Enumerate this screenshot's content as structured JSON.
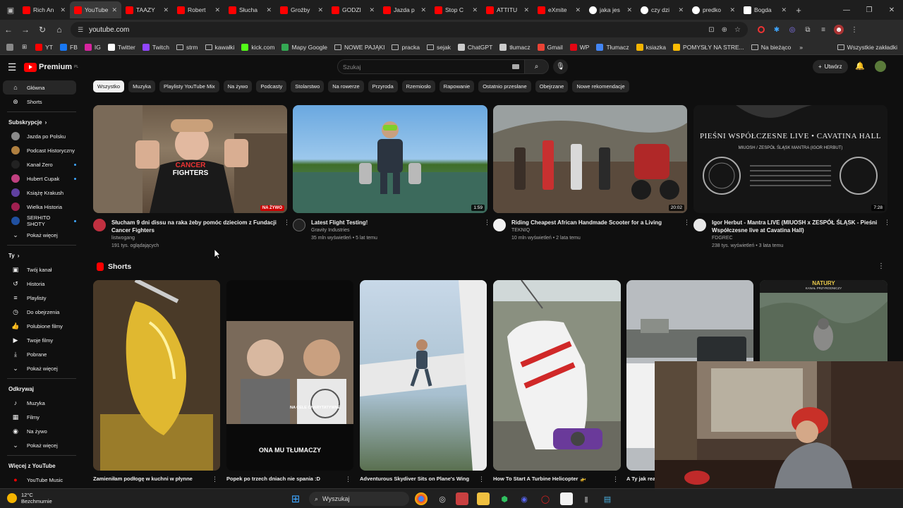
{
  "browser": {
    "tabs": [
      {
        "title": "Rich An",
        "icon": "youtube-icon"
      },
      {
        "title": "YouTube",
        "icon": "youtube-icon",
        "active": true
      },
      {
        "title": "TAAZY",
        "icon": "youtube-icon"
      },
      {
        "title": "Robert",
        "icon": "youtube-icon"
      },
      {
        "title": "Słucha",
        "icon": "youtube-icon"
      },
      {
        "title": "Groźby",
        "icon": "youtube-icon"
      },
      {
        "title": "GODZI",
        "icon": "youtube-icon"
      },
      {
        "title": "Jazda p",
        "icon": "youtube-icon"
      },
      {
        "title": "Stop C",
        "icon": "youtube-icon"
      },
      {
        "title": "ATTITU",
        "icon": "youtube-icon"
      },
      {
        "title": "eXmite",
        "icon": "youtube-icon"
      },
      {
        "title": "jaka jes",
        "icon": "google-icon"
      },
      {
        "title": "czy dzi",
        "icon": "google-icon"
      },
      {
        "title": "predko",
        "icon": "google-icon"
      },
      {
        "title": "Bogda",
        "icon": "wikipedia-icon"
      }
    ],
    "url": "youtube.com",
    "bookmarks": [
      {
        "label": "YT",
        "color": "#ff0000"
      },
      {
        "label": "FB",
        "color": "#1877f2"
      },
      {
        "label": "IG",
        "color": "#d6249f"
      },
      {
        "label": "Twitter",
        "color": "#ffffff"
      },
      {
        "label": "Twitch",
        "color": "#9146ff"
      },
      {
        "label": "strm",
        "folder": true
      },
      {
        "label": "kawałki",
        "folder": true
      },
      {
        "label": "kick.com",
        "color": "#53fc18"
      },
      {
        "label": "Mapy Google",
        "color": "#34a853"
      },
      {
        "label": "NOWE PAJĄKI",
        "folder": true
      },
      {
        "label": "pracka",
        "folder": true
      },
      {
        "label": "sejak",
        "folder": true
      },
      {
        "label": "ChatGPT",
        "color": "#cccccc"
      },
      {
        "label": "tłumacz",
        "color": "#cccccc"
      },
      {
        "label": "Gmail",
        "color": "#ea4335"
      },
      {
        "label": "WP",
        "color": "#e30613"
      },
      {
        "label": "Tłumacz",
        "color": "#4285f4"
      },
      {
        "label": "ksiazka",
        "color": "#f4b400"
      },
      {
        "label": "POMYSŁY NA STRE...",
        "color": "#fbbc04"
      },
      {
        "label": "Na bieżąco",
        "folder": true
      }
    ],
    "all_bookmarks": "Wszystkie zakładki"
  },
  "youtube": {
    "logo": "Premium",
    "logo_sup": "PL",
    "search_placeholder": "Szukaj",
    "create_label": "Utwórz",
    "sidebar": {
      "main": [
        {
          "label": "Główna",
          "icon": "home-icon"
        },
        {
          "label": "Shorts",
          "icon": "shorts-icon"
        }
      ],
      "subs_title": "Subskrypcje",
      "subs": [
        {
          "label": "Jazda po Polsku",
          "color": "#8a8a8a",
          "dot": false
        },
        {
          "label": "Podcast Historyczny",
          "color": "#b08040",
          "dot": false
        },
        {
          "label": "Kanał Zero",
          "color": "#222222",
          "dot": true
        },
        {
          "label": "Hubert Cupak",
          "color": "#c04080",
          "dot": true
        },
        {
          "label": "Książę Krakush",
          "color": "#6040a0",
          "dot": false
        },
        {
          "label": "Wielka Historia",
          "color": "#a02050",
          "dot": false
        },
        {
          "label": "SERHITO SHOTY",
          "color": "#2050a0",
          "dot": true
        }
      ],
      "show_more_1": "Pokaż więcej",
      "you_title": "Ty",
      "you": [
        {
          "label": "Twój kanał",
          "icon": "channel-icon"
        },
        {
          "label": "Historia",
          "icon": "history-icon"
        },
        {
          "label": "Playlisty",
          "icon": "playlist-icon"
        },
        {
          "label": "Do obejrzenia",
          "icon": "clock-icon"
        },
        {
          "label": "Polubione filmy",
          "icon": "thumbs-up-icon"
        },
        {
          "label": "Twoje filmy",
          "icon": "video-icon"
        },
        {
          "label": "Pobrane",
          "icon": "download-icon"
        }
      ],
      "show_more_2": "Pokaż więcej",
      "explore_title": "Odkrywaj",
      "explore": [
        {
          "label": "Muzyka",
          "icon": "music-icon"
        },
        {
          "label": "Filmy",
          "icon": "film-icon"
        },
        {
          "label": "Na żywo",
          "icon": "live-icon"
        }
      ],
      "show_more_3": "Pokaż więcej",
      "more_title": "Więcej z YouTube",
      "more": [
        {
          "label": "YouTube Music",
          "icon": "youtube-music-icon"
        }
      ]
    },
    "chips": [
      "Wszystko",
      "Muzyka",
      "Playlisty YouTube Mix",
      "Na żywo",
      "Podcasty",
      "Stolarstwo",
      "Na rowerze",
      "Przyroda",
      "Rzemiosło",
      "Rapowanie",
      "Ostatnio przesłane",
      "Obejrzane",
      "Nowe rekomendacje"
    ],
    "videos": [
      {
        "title_1": "Słucham 9 dni dissu na raka żeby pomóc dzieciom z Fundacji",
        "title_2": "Cancer Fighters",
        "channel": "listwogang",
        "meta": "191 tys. oglądających",
        "badge": "NA ŻYWO",
        "shirt_1": "CANCER",
        "shirt_2": "FIGHTERS"
      },
      {
        "title_1": "Latest Flight Testing!",
        "title_2": "",
        "channel": "Gravity Industries",
        "meta": "35 mln wyświetleń • 5 lat temu",
        "badge": "1:59"
      },
      {
        "title_1": "Riding Cheapest African Handmade Scooter for a Living",
        "title_2": "",
        "channel": "TEKNIQ",
        "meta": "10 mln wyświetleń • 2 lata temu",
        "badge": "20:02"
      },
      {
        "title_1": "Igor Herbut - Mantra LIVE (MIUOSH x ZESPÓŁ ŚLĄSK - Pieśni",
        "title_2": "Współczesne live at Cavatina Hall)",
        "channel": "FDGREC",
        "meta": "238 tys. wyświetleń • 3 lata temu",
        "badge": "7:28",
        "thumb_title": "PIEŚNI WSPÓŁCZESNE LIVE • CAVATINA HALL",
        "thumb_sub": "MIUOSH / ZESPÓŁ ŚLĄSK     MANTRA (IGOR HERBUT)"
      }
    ],
    "shorts_title": "Shorts",
    "shorts": [
      {
        "title": "Zamieniłam podłogę w kuchni w płynne"
      },
      {
        "title": "Popek po trzech dniach nie spania :D",
        "overlay": "ONA MU TŁUMACZY",
        "overlay_small": "NA CELE CHARYTATYWNE"
      },
      {
        "title": "Adventurous Skydiver Sits on Plane's Wing"
      },
      {
        "title": "How To Start A Turbine Helicopter 🚁"
      },
      {
        "title": "A Ty jak rea"
      },
      {
        "title": "",
        "overlay": "NATURY",
        "overlay_small": "KANAŁ PRZYRODNICZY"
      }
    ]
  },
  "taskbar": {
    "weather_temp": "12°C",
    "weather_desc": "Bezchmurnie",
    "search": "Wyszukaj"
  }
}
